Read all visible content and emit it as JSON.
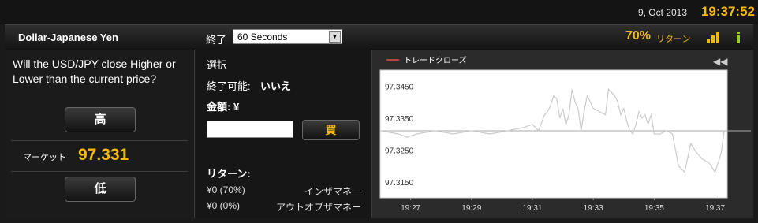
{
  "topbar": {
    "date": "9, Oct 2013",
    "time": "19:37:52"
  },
  "header": {
    "pair": "Dollar-Japanese Yen",
    "expiry_label": "終了",
    "expiry_value": "60 Seconds",
    "return_pct": "70%",
    "return_label": "リターン"
  },
  "left": {
    "question": "Will the USD/JPY close Higher or Lower than the current price?",
    "high_button": "高",
    "market_label": "マーケット",
    "market_value": "97.331",
    "low_button": "低"
  },
  "middle": {
    "select_label": "選択",
    "expiry_possible_label": "終了可能:",
    "expiry_possible_value": "いいえ",
    "amount_label": "金額: ¥",
    "amount_value": "",
    "buy_button": "買",
    "returns_title": "リターン:",
    "in_money_value": "¥0 (70%)",
    "in_money_label": "インザマネー",
    "out_money_value": "¥0 (0%)",
    "out_money_label": "アウトオブザマネー"
  },
  "colors": {
    "accent": "#f2b90f",
    "legend_line": "#d9534f",
    "price_line": "#cccccc"
  },
  "chart_data": {
    "type": "line",
    "legend": [
      "トレードクローズ"
    ],
    "ylim": [
      97.31,
      97.35
    ],
    "yticks": [
      97.345,
      97.335,
      97.325,
      97.315
    ],
    "ytick_labels": [
      "97.3450",
      "97.3350",
      "97.3250",
      "97.3150"
    ],
    "xlim": [
      0,
      11.4
    ],
    "xtick_pos": [
      1,
      3,
      5,
      7,
      9,
      11
    ],
    "xtick_labels": [
      "19:27",
      "19:29",
      "19:31",
      "19:33",
      "19:35",
      "19:37"
    ],
    "reference_line": 97.331,
    "series": [
      {
        "x": [
          0,
          0.6,
          0.9,
          1.2,
          1.8,
          2.4,
          3.0,
          3.6,
          4.2,
          4.7,
          5.0,
          5.2,
          5.4,
          5.5,
          5.6,
          5.7,
          5.8,
          5.9,
          6.0,
          6.1,
          6.2,
          6.3,
          6.4,
          6.5,
          6.6,
          6.7,
          6.8,
          7.0,
          7.2,
          7.4,
          7.5,
          7.7,
          7.8,
          7.9,
          8.0,
          8.1,
          8.2,
          8.3,
          8.4,
          8.5,
          8.6,
          8.7,
          8.8,
          8.9,
          9.0,
          9.2,
          9.4,
          9.6,
          9.8,
          10.0,
          10.2,
          10.4,
          10.6,
          10.8,
          11.0,
          11.2,
          11.3
        ],
        "y": [
          97.331,
          97.33,
          97.329,
          97.33,
          97.331,
          97.33,
          97.331,
          97.33,
          97.331,
          97.332,
          97.333,
          97.331,
          97.336,
          97.337,
          97.339,
          97.342,
          97.341,
          97.335,
          97.338,
          97.333,
          97.336,
          97.344,
          97.34,
          97.338,
          97.331,
          97.337,
          97.342,
          97.338,
          97.337,
          97.336,
          97.344,
          97.342,
          97.34,
          97.336,
          97.338,
          97.334,
          97.331,
          97.33,
          97.333,
          97.337,
          97.335,
          97.336,
          97.333,
          97.336,
          97.33,
          97.33,
          97.331,
          97.33,
          97.32,
          97.318,
          97.327,
          97.324,
          97.322,
          97.321,
          97.318,
          97.324,
          97.331
        ]
      }
    ]
  }
}
